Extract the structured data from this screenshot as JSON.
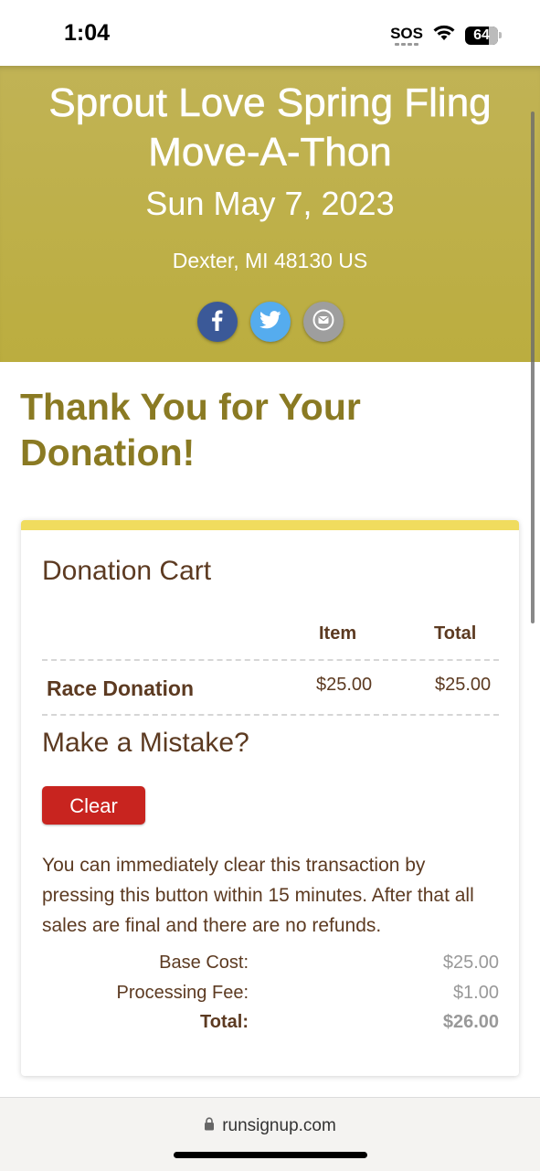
{
  "status_bar": {
    "time": "1:04",
    "sos": "SOS",
    "battery": "64"
  },
  "event": {
    "title_line1": "Sprout Love Spring Fling",
    "title_line2": "Move-A-Thon",
    "date": "Sun May 7, 2023",
    "location": "Dexter, MI 48130 US"
  },
  "share": {
    "facebook_icon": "facebook-icon",
    "twitter_icon": "twitter-icon",
    "email_icon": "email-icon"
  },
  "page": {
    "heading": "Thank You for Your Donation!"
  },
  "cart": {
    "title": "Donation Cart",
    "columns": {
      "item": "Item",
      "total": "Total"
    },
    "rows": [
      {
        "name": "Race Donation",
        "item": "$25.00",
        "total": "$25.00"
      }
    ]
  },
  "mistake": {
    "title": "Make a Mistake?",
    "clear_label": "Clear",
    "description": "You can immediately clear this transaction by pressing this button within 15 minutes. After that all sales are final and there are no refunds."
  },
  "summary": {
    "base_cost_label": "Base Cost:",
    "base_cost_value": "$25.00",
    "processing_fee_label": "Processing Fee:",
    "processing_fee_value": "$1.00",
    "total_label": "Total:",
    "total_value": "$26.00"
  },
  "browser": {
    "url": "runsignup.com"
  },
  "colors": {
    "hero": "#bbad3f",
    "heading": "#8a7a23",
    "text_brown": "#5c3a21",
    "card_accent": "#f0dc5e",
    "clear_button": "#c8241f"
  }
}
